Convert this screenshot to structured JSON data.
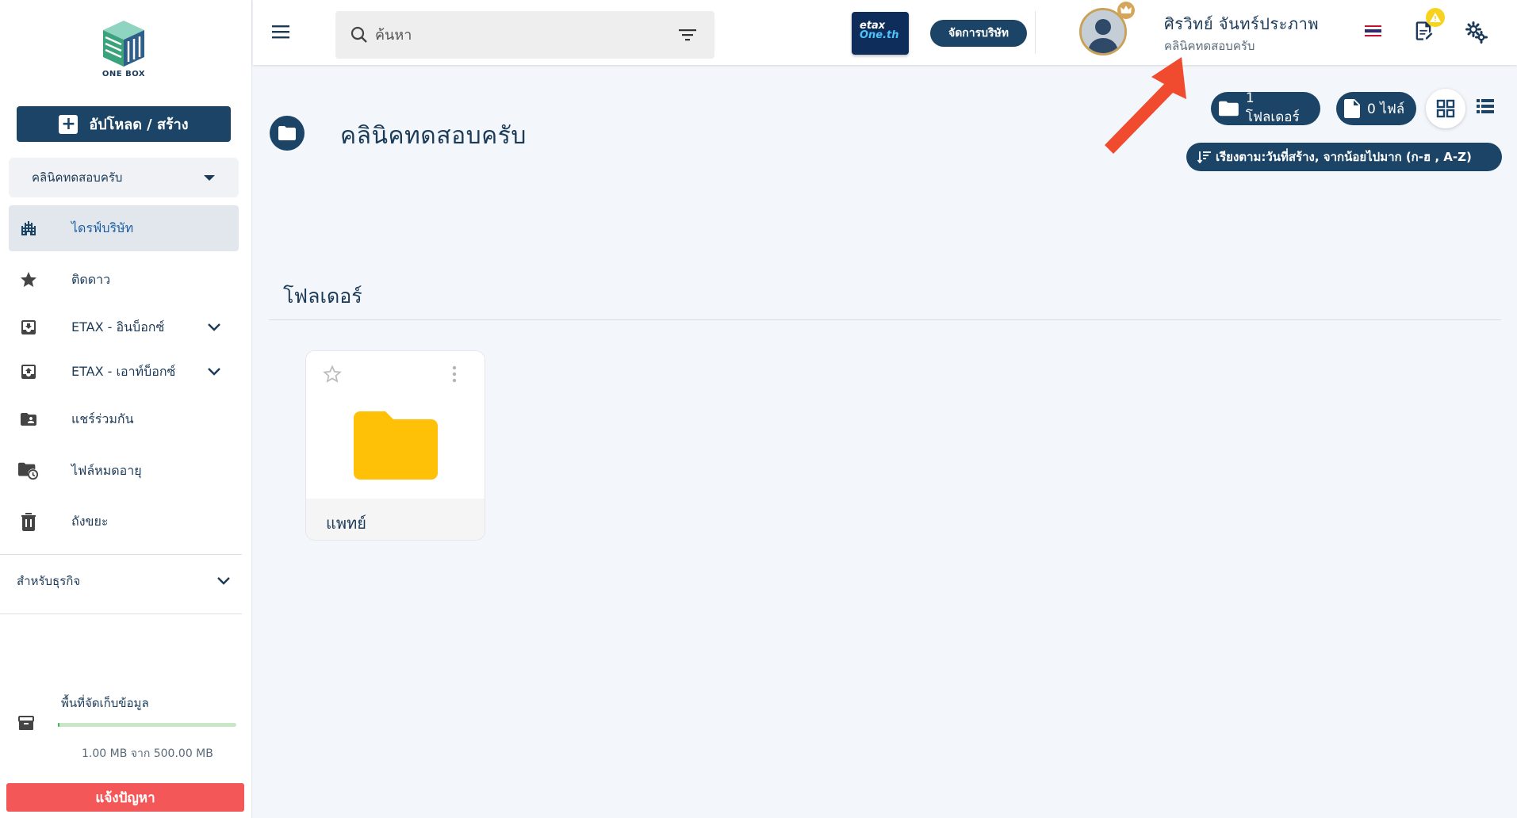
{
  "brand": {
    "name": "ONE BOX"
  },
  "sidebar": {
    "upload_label": "อัปโหลด / สร้าง",
    "company_select": "คลินิคทดสอบครับ",
    "items": [
      {
        "label": "ไดรฟ์บริษัท",
        "icon": "building-icon",
        "active": true
      },
      {
        "label": "ติดดาว",
        "icon": "star-icon"
      },
      {
        "label": "ETAX - อินบ็อกซ์",
        "icon": "inbox-download-icon",
        "expandable": true
      },
      {
        "label": "ETAX - เอาท์บ็อกซ์",
        "icon": "inbox-upload-icon",
        "expandable": true
      },
      {
        "label": "แชร์ร่วมกัน",
        "icon": "shared-folder-icon"
      },
      {
        "label": "ไฟล์หมดอายุ",
        "icon": "expired-file-icon"
      },
      {
        "label": "ถังขยะ",
        "icon": "trash-icon"
      }
    ],
    "business_label": "สำหรับธุรกิจ",
    "storage": {
      "title": "พื้นที่จัดเก็บข้อมูล",
      "text": "1.00 MB จาก 500.00 MB",
      "used_fraction": 0.002
    },
    "report_label": "แจ้งปัญหา"
  },
  "topbar": {
    "search_placeholder": "ค้นหา",
    "etax_logo": {
      "line1": "etax",
      "line2": "One.th"
    },
    "manage_label": "จัดการบริษัท",
    "user": {
      "name": "ศิรวิทย์ จันทร์ประภาพ",
      "company": "คลินิคทดสอบครับ"
    }
  },
  "main": {
    "title": "คลินิคทดสอบครับ",
    "folder_count_label": "1 โฟลเดอร์",
    "file_count_label": "0 ไฟล์",
    "sort_label": "เรียงตาม:วันที่สร้าง, จากน้อยไปมาก (ก-ฮ , A-Z)",
    "section_title": "โฟลเดอร์",
    "folders": [
      {
        "name": "แพทย์"
      }
    ]
  },
  "colors": {
    "primary": "#1b4466",
    "accent_red": "#f45757",
    "folder_yellow": "#ffc107",
    "arrow": "#f04a2f"
  }
}
